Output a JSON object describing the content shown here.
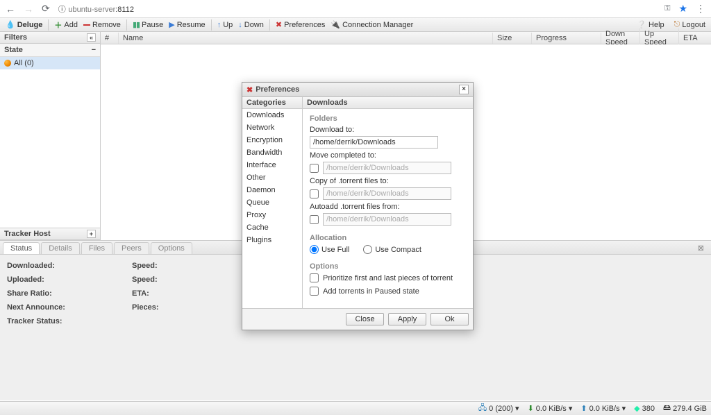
{
  "browser": {
    "url_insecure_label": "ⓘ",
    "url_host": "ubuntu-server",
    "url_port": ":8112"
  },
  "toolbar": {
    "brand": "Deluge",
    "add": "Add",
    "remove": "Remove",
    "pause": "Pause",
    "resume": "Resume",
    "up": "Up",
    "down": "Down",
    "preferences": "Preferences",
    "connection_manager": "Connection Manager",
    "help": "Help",
    "logout": "Logout"
  },
  "filters": {
    "title": "Filters",
    "state_label": "State",
    "all_label": "All (0)",
    "tracker_host": "Tracker Host"
  },
  "grid": {
    "cols": {
      "num": "#",
      "name": "Name",
      "size": "Size",
      "progress": "Progress",
      "down": "Down Speed",
      "up": "Up Speed",
      "eta": "ETA"
    }
  },
  "tabs": {
    "status": "Status",
    "details": "Details",
    "files": "Files",
    "peers": "Peers",
    "options": "Options"
  },
  "details": {
    "downloaded": "Downloaded:",
    "uploaded": "Uploaded:",
    "share_ratio": "Share Ratio:",
    "next_announce": "Next Announce:",
    "tracker_status": "Tracker Status:",
    "speed1": "Speed:",
    "speed2": "Speed:",
    "eta": "ETA:",
    "pieces": "Pieces:"
  },
  "statusbar": {
    "conn": "0 (200)",
    "down": "0.0 KiB/s",
    "up": "0.0 KiB/s",
    "dht": "380",
    "disk": "279.4 GiB"
  },
  "dialog": {
    "title": "Preferences",
    "categories_label": "Categories",
    "categories": [
      "Downloads",
      "Network",
      "Encryption",
      "Bandwidth",
      "Interface",
      "Other",
      "Daemon",
      "Queue",
      "Proxy",
      "Cache",
      "Plugins"
    ],
    "selected_category": "Downloads",
    "page_title": "Downloads",
    "folders_label": "Folders",
    "download_to_label": "Download to:",
    "download_to_value": "/home/derrik/Downloads",
    "move_completed_label": "Move completed to:",
    "move_completed_value": "/home/derrik/Downloads",
    "copy_torrent_label": "Copy of .torrent files to:",
    "copy_torrent_value": "/home/derrik/Downloads",
    "autoadd_label": "Autoadd .torrent files from:",
    "autoadd_value": "/home/derrik/Downloads",
    "allocation_label": "Allocation",
    "use_full": "Use Full",
    "use_compact": "Use Compact",
    "options_label": "Options",
    "prioritize": "Prioritize first and last pieces of torrent",
    "add_paused": "Add torrents in Paused state",
    "close": "Close",
    "apply": "Apply",
    "ok": "Ok"
  }
}
